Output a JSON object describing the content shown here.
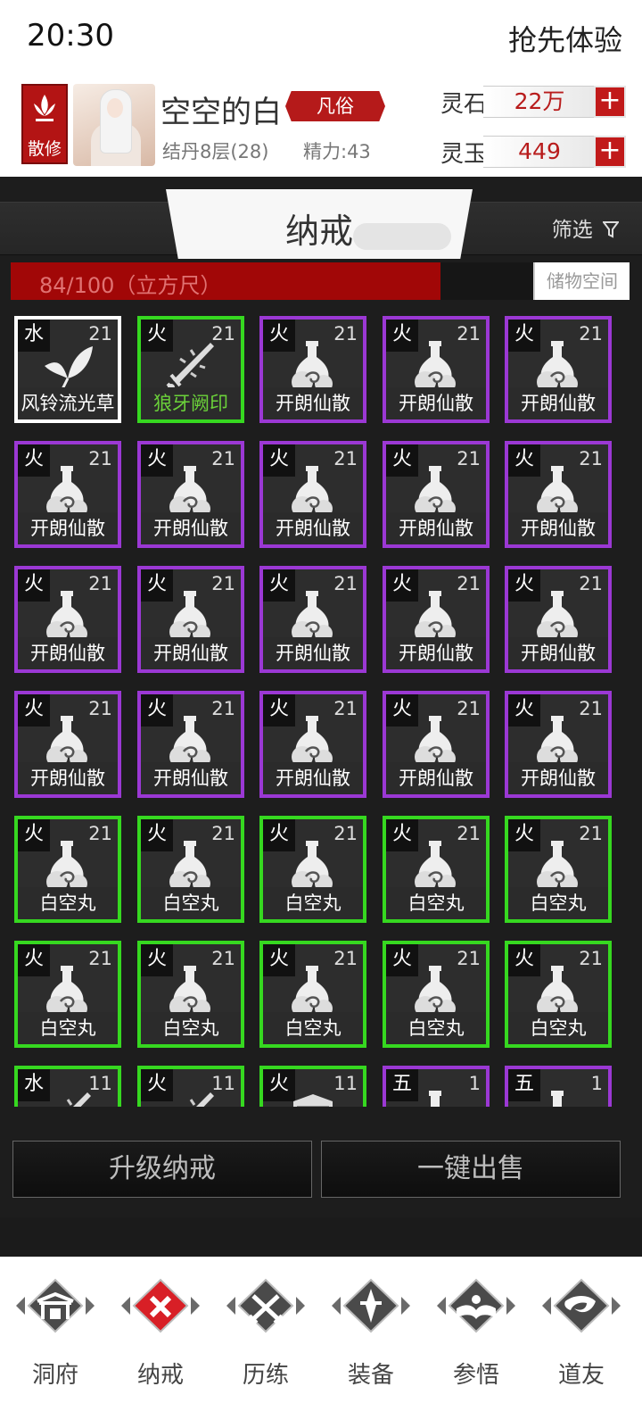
{
  "status": {
    "time": "20:30",
    "early_access": "抢先体验"
  },
  "header": {
    "sect": "散修",
    "player_name": "空空的白",
    "rank": "凡俗",
    "realm": "结丹8层(28)",
    "energy": "精力:43",
    "currencies": [
      {
        "label": "灵石",
        "value": "22万",
        "add": "+"
      },
      {
        "label": "灵玉",
        "value": "449",
        "add": "+"
      }
    ]
  },
  "panel": {
    "title": "纳戒",
    "filter": "筛选",
    "capacity": {
      "text": "84/100（立方尺）",
      "fill_fraction": 0.84,
      "button": "储物空间"
    }
  },
  "items": [
    {
      "element": "水",
      "count": "21",
      "name": "风铃流光草",
      "rarity": "white",
      "icon": "herb-icon"
    },
    {
      "element": "火",
      "count": "21",
      "name": "狼牙阙印",
      "rarity": "green",
      "icon": "sword-icon"
    },
    {
      "element": "火",
      "count": "21",
      "name": "开朗仙散",
      "rarity": "purple",
      "icon": "flask-icon"
    },
    {
      "element": "火",
      "count": "21",
      "name": "开朗仙散",
      "rarity": "purple",
      "icon": "flask-icon"
    },
    {
      "element": "火",
      "count": "21",
      "name": "开朗仙散",
      "rarity": "purple",
      "icon": "flask-icon"
    },
    {
      "element": "火",
      "count": "21",
      "name": "开朗仙散",
      "rarity": "purple",
      "icon": "flask-icon"
    },
    {
      "element": "火",
      "count": "21",
      "name": "开朗仙散",
      "rarity": "purple",
      "icon": "flask-icon"
    },
    {
      "element": "火",
      "count": "21",
      "name": "开朗仙散",
      "rarity": "purple",
      "icon": "flask-icon"
    },
    {
      "element": "火",
      "count": "21",
      "name": "开朗仙散",
      "rarity": "purple",
      "icon": "flask-icon"
    },
    {
      "element": "火",
      "count": "21",
      "name": "开朗仙散",
      "rarity": "purple",
      "icon": "flask-icon"
    },
    {
      "element": "火",
      "count": "21",
      "name": "开朗仙散",
      "rarity": "purple",
      "icon": "flask-icon"
    },
    {
      "element": "火",
      "count": "21",
      "name": "开朗仙散",
      "rarity": "purple",
      "icon": "flask-icon"
    },
    {
      "element": "火",
      "count": "21",
      "name": "开朗仙散",
      "rarity": "purple",
      "icon": "flask-icon"
    },
    {
      "element": "火",
      "count": "21",
      "name": "开朗仙散",
      "rarity": "purple",
      "icon": "flask-icon"
    },
    {
      "element": "火",
      "count": "21",
      "name": "开朗仙散",
      "rarity": "purple",
      "icon": "flask-icon"
    },
    {
      "element": "火",
      "count": "21",
      "name": "开朗仙散",
      "rarity": "purple",
      "icon": "flask-icon"
    },
    {
      "element": "火",
      "count": "21",
      "name": "开朗仙散",
      "rarity": "purple",
      "icon": "flask-icon"
    },
    {
      "element": "火",
      "count": "21",
      "name": "开朗仙散",
      "rarity": "purple",
      "icon": "flask-icon"
    },
    {
      "element": "火",
      "count": "21",
      "name": "开朗仙散",
      "rarity": "purple",
      "icon": "flask-icon"
    },
    {
      "element": "火",
      "count": "21",
      "name": "开朗仙散",
      "rarity": "purple",
      "icon": "flask-icon"
    },
    {
      "element": "火",
      "count": "21",
      "name": "白空丸",
      "rarity": "green",
      "icon": "flask-icon"
    },
    {
      "element": "火",
      "count": "21",
      "name": "白空丸",
      "rarity": "green",
      "icon": "flask-icon"
    },
    {
      "element": "火",
      "count": "21",
      "name": "白空丸",
      "rarity": "green",
      "icon": "flask-icon"
    },
    {
      "element": "火",
      "count": "21",
      "name": "白空丸",
      "rarity": "green",
      "icon": "flask-icon"
    },
    {
      "element": "火",
      "count": "21",
      "name": "白空丸",
      "rarity": "green",
      "icon": "flask-icon"
    },
    {
      "element": "火",
      "count": "21",
      "name": "白空丸",
      "rarity": "green",
      "icon": "flask-icon"
    },
    {
      "element": "火",
      "count": "21",
      "name": "白空丸",
      "rarity": "green",
      "icon": "flask-icon"
    },
    {
      "element": "火",
      "count": "21",
      "name": "白空丸",
      "rarity": "green",
      "icon": "flask-icon"
    },
    {
      "element": "火",
      "count": "21",
      "name": "白空丸",
      "rarity": "green",
      "icon": "flask-icon"
    },
    {
      "element": "火",
      "count": "21",
      "name": "白空丸",
      "rarity": "green",
      "icon": "flask-icon"
    },
    {
      "element": "水",
      "count": "11",
      "name": "",
      "rarity": "green",
      "icon": "sword-icon"
    },
    {
      "element": "火",
      "count": "11",
      "name": "",
      "rarity": "green",
      "icon": "sword-icon"
    },
    {
      "element": "火",
      "count": "11",
      "name": "",
      "rarity": "green",
      "icon": "shield-icon"
    },
    {
      "element": "五",
      "count": "1",
      "name": "",
      "rarity": "purple",
      "icon": "flask-icon"
    },
    {
      "element": "五",
      "count": "1",
      "name": "",
      "rarity": "purple",
      "icon": "flask-icon"
    }
  ],
  "actions": {
    "upgrade": "升级纳戒",
    "sell_all": "一键出售"
  },
  "nav": [
    {
      "label": "洞府",
      "icon": "gate-icon",
      "active": false
    },
    {
      "label": "纳戒",
      "icon": "ring-icon",
      "active": true
    },
    {
      "label": "历练",
      "icon": "crossed-swords-icon",
      "active": false
    },
    {
      "label": "装备",
      "icon": "dagger-icon",
      "active": false
    },
    {
      "label": "参悟",
      "icon": "book-icon",
      "active": false
    },
    {
      "label": "道友",
      "icon": "friends-icon",
      "active": false
    }
  ],
  "colors": {
    "accent_red": "#b51a1a",
    "rarity_white": "#ffffff",
    "rarity_green": "#36d820",
    "rarity_purple": "#9b38d4",
    "panel_bg": "#1d1d1d"
  }
}
